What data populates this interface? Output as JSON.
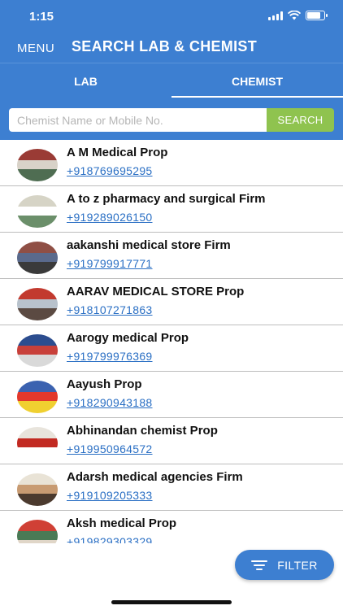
{
  "status_bar": {
    "time": "1:15"
  },
  "header": {
    "menu_label": "MENU",
    "title": "SEARCH LAB & CHEMIST"
  },
  "tabs": [
    {
      "label": "LAB",
      "active": false
    },
    {
      "label": "CHEMIST",
      "active": true
    }
  ],
  "search": {
    "placeholder": "Chemist Name or Mobile No.",
    "value": "",
    "button_label": "SEARCH"
  },
  "chemists": [
    {
      "name": "A M Medical Prop",
      "phone": "+918769695295",
      "thumb_colors": [
        "#9a3b35",
        "#d8d2c8",
        "#4f6d52"
      ]
    },
    {
      "name": "A to z pharmacy and surgical Firm",
      "phone": "+919289026150",
      "thumb_colors": [
        "#d6d4c6",
        "#ffffff",
        "#6b8f6a"
      ]
    },
    {
      "name": "aakanshi medical store Firm",
      "phone": "+919799917771",
      "thumb_colors": [
        "#8f4f45",
        "#5a6a8c",
        "#3a3a3a"
      ]
    },
    {
      "name": "AARAV MEDICAL STORE Prop",
      "phone": "+918107271863",
      "thumb_colors": [
        "#c23a2f",
        "#b8c2cc",
        "#5b4a42"
      ]
    },
    {
      "name": "Aarogy medical Prop",
      "phone": "+919799976369",
      "thumb_colors": [
        "#2c4d8f",
        "#c8403a",
        "#d9d9d9"
      ]
    },
    {
      "name": "Aayush Prop",
      "phone": "+918290943188",
      "thumb_colors": [
        "#3b62b0",
        "#e2382c",
        "#f0d030"
      ]
    },
    {
      "name": "Abhinandan chemist Prop",
      "phone": "+919950964572",
      "thumb_colors": [
        "#e8e4dc",
        "#c22a22",
        "#ffffff"
      ]
    },
    {
      "name": "Adarsh medical agencies Firm",
      "phone": "+919109205333",
      "thumb_colors": [
        "#e9e3d6",
        "#c89b72",
        "#4b3a2e"
      ]
    },
    {
      "name": "Aksh medical Prop",
      "phone": "+919829303329",
      "thumb_colors": [
        "#d04035",
        "#4a7a55",
        "#e0d6c8"
      ]
    }
  ],
  "filter": {
    "label": "FILTER"
  },
  "colors": {
    "primary": "#3d7fd1",
    "search_button": "#8fc34f",
    "link": "#2a6fc4"
  }
}
